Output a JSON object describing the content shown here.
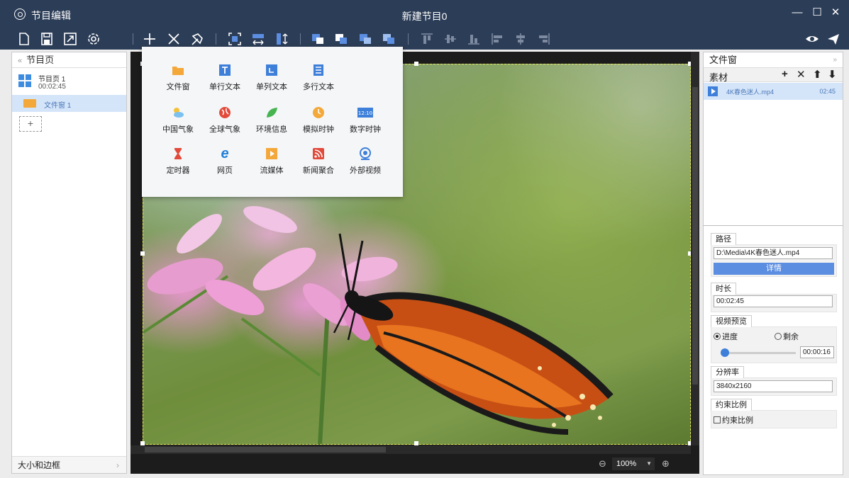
{
  "titlebar": {
    "app_name": "节目编辑",
    "document_title": "新建节目0",
    "minimize": "—",
    "maximize": "☐",
    "close": "✕"
  },
  "toolbar": {
    "file_icons": [
      "new-file-icon",
      "save-icon",
      "resize-icon",
      "settings-icon"
    ],
    "edit_icons": [
      "add-icon",
      "delete-icon",
      "pin-icon"
    ],
    "layout_icons": [
      "fit-screen-icon",
      "stretch-horizontal-icon",
      "stretch-vertical-icon"
    ],
    "order_icons": [
      "bring-to-front-icon",
      "send-to-back-icon",
      "bring-forward-icon",
      "send-backward-icon"
    ],
    "align_icons": [
      "align-top-icon",
      "align-middle-icon",
      "align-bottom-icon",
      "align-left-icon",
      "align-center-icon",
      "align-right-icon"
    ],
    "right_icons": [
      "preview-eye-icon",
      "send-icon"
    ]
  },
  "left_panel": {
    "title": "节目页",
    "collapse": "«",
    "pages": [
      {
        "name": "节目页 1",
        "duration": "00:02:45"
      }
    ],
    "windows": [
      {
        "name": "文件窗 1"
      }
    ],
    "add_label": "+",
    "footer": "大小和边框",
    "footer_arrow": "›"
  },
  "popup": {
    "rows": [
      [
        {
          "label": "文件窗",
          "icon": "folder-icon",
          "color": "#f4a83a"
        },
        {
          "label": "单行文本",
          "icon": "single-line-text-icon",
          "color": "#3e7fd9"
        },
        {
          "label": "单列文本",
          "icon": "single-column-text-icon",
          "color": "#3e7fd9"
        },
        {
          "label": "多行文本",
          "icon": "multi-line-text-icon",
          "color": "#3e7fd9"
        }
      ],
      [
        {
          "label": "中国气象",
          "icon": "china-weather-icon",
          "color": "#5aaee8"
        },
        {
          "label": "全球气象",
          "icon": "global-weather-icon",
          "color": "#e24a3b"
        },
        {
          "label": "环境信息",
          "icon": "environment-leaf-icon",
          "color": "#46b450"
        },
        {
          "label": "模拟时钟",
          "icon": "analog-clock-icon",
          "color": "#f4a83a"
        },
        {
          "label": "数字时钟",
          "icon": "digital-clock-icon",
          "color": "#3e7fd9"
        }
      ],
      [
        {
          "label": "定时器",
          "icon": "timer-hourglass-icon",
          "color": "#e24a3b"
        },
        {
          "label": "网页",
          "icon": "web-page-icon",
          "color": "#1f7fd8"
        },
        {
          "label": "流媒体",
          "icon": "streaming-media-icon",
          "color": "#f4a83a"
        },
        {
          "label": "新闻聚合",
          "icon": "rss-news-icon",
          "color": "#e24a3b"
        },
        {
          "label": "外部视频",
          "icon": "external-video-icon",
          "color": "#3e7fd9"
        }
      ]
    ],
    "digital_clock_text": "12:10",
    "web_icon_char": "e"
  },
  "canvas": {
    "zoom": "100%",
    "zoom_dropdown": "▼",
    "zoom_out": "⊖",
    "zoom_in": "⊕"
  },
  "right_panel": {
    "title": "文件窗",
    "expand": "»",
    "source_label": "素材",
    "source_buttons": [
      "+",
      "✕",
      "⬆",
      "⬇"
    ],
    "files": [
      {
        "name": "4K春色迷人.mp4",
        "duration": "02:45"
      }
    ],
    "props": {
      "path_label": "路径",
      "path_value": "D:\\Media\\4K春色迷人.mp4",
      "detail_button": "详情",
      "duration_label": "时长",
      "duration_value": "00:02:45",
      "preview_label": "视频预览",
      "radio_progress": "进度",
      "radio_remaining": "剩余",
      "preview_time": "00:00:16",
      "resolution_label": "分辨率",
      "resolution_value": "3840x2160",
      "ratio_label": "约束比例",
      "ratio_checkbox": "约束比例"
    }
  }
}
